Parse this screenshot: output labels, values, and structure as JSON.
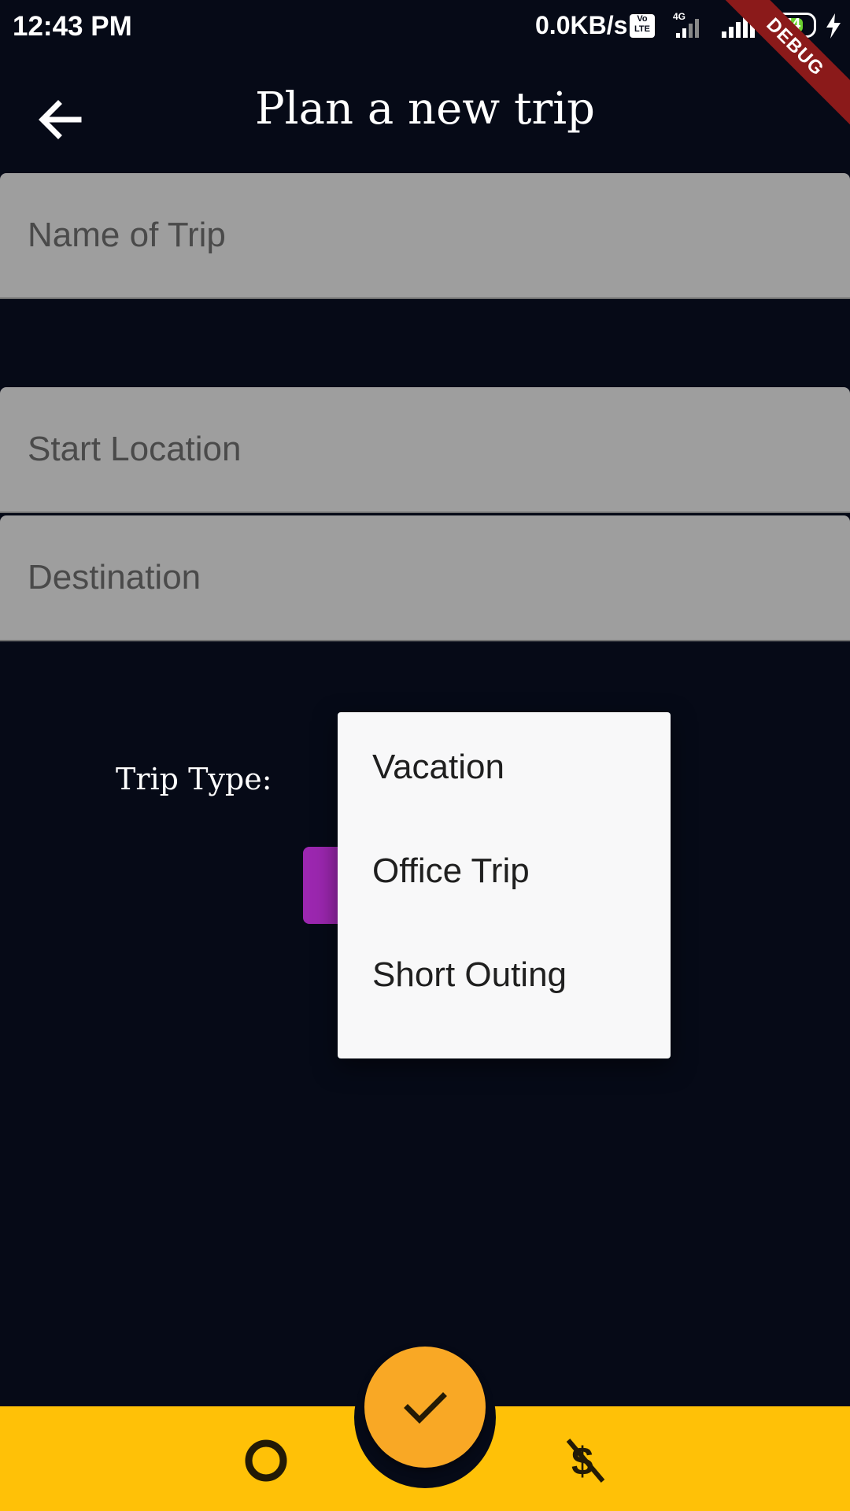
{
  "status_bar": {
    "time": "12:43 PM",
    "network_speed": "0.0KB/s",
    "volte": "Vo LTE",
    "network_type": "4G",
    "battery_level": "74",
    "debug_banner": "DEBUG",
    "icons": [
      "volte-icon",
      "signal-4g-icon",
      "signal-icon",
      "battery-icon",
      "charging-icon"
    ]
  },
  "app_bar": {
    "back_icon": "arrow-left-icon",
    "title": "Plan a new trip"
  },
  "form": {
    "name_of_trip": {
      "value": "",
      "placeholder": "Name of Trip"
    },
    "start_location": {
      "value": "",
      "placeholder": "Start Location"
    },
    "destination": {
      "value": "",
      "placeholder": "Destination"
    },
    "trip_type_label": "Trip Type:"
  },
  "trip_type_menu": {
    "options": [
      {
        "label": "Vacation"
      },
      {
        "label": "Office Trip"
      },
      {
        "label": "Short Outing"
      }
    ]
  },
  "bottom_nav": {
    "left_icon": "circle-icon",
    "fab_icon": "check-icon",
    "right_icon": "money-off-icon"
  },
  "colors": {
    "background": "#060a17",
    "field": "#9e9e9e",
    "menu": "#f8f8f9",
    "dropdown_button": "#9c27b0",
    "bottom_bar": "#ffc107",
    "fab": "#f9a825",
    "debug_ribbon": "#8b1a1a"
  }
}
